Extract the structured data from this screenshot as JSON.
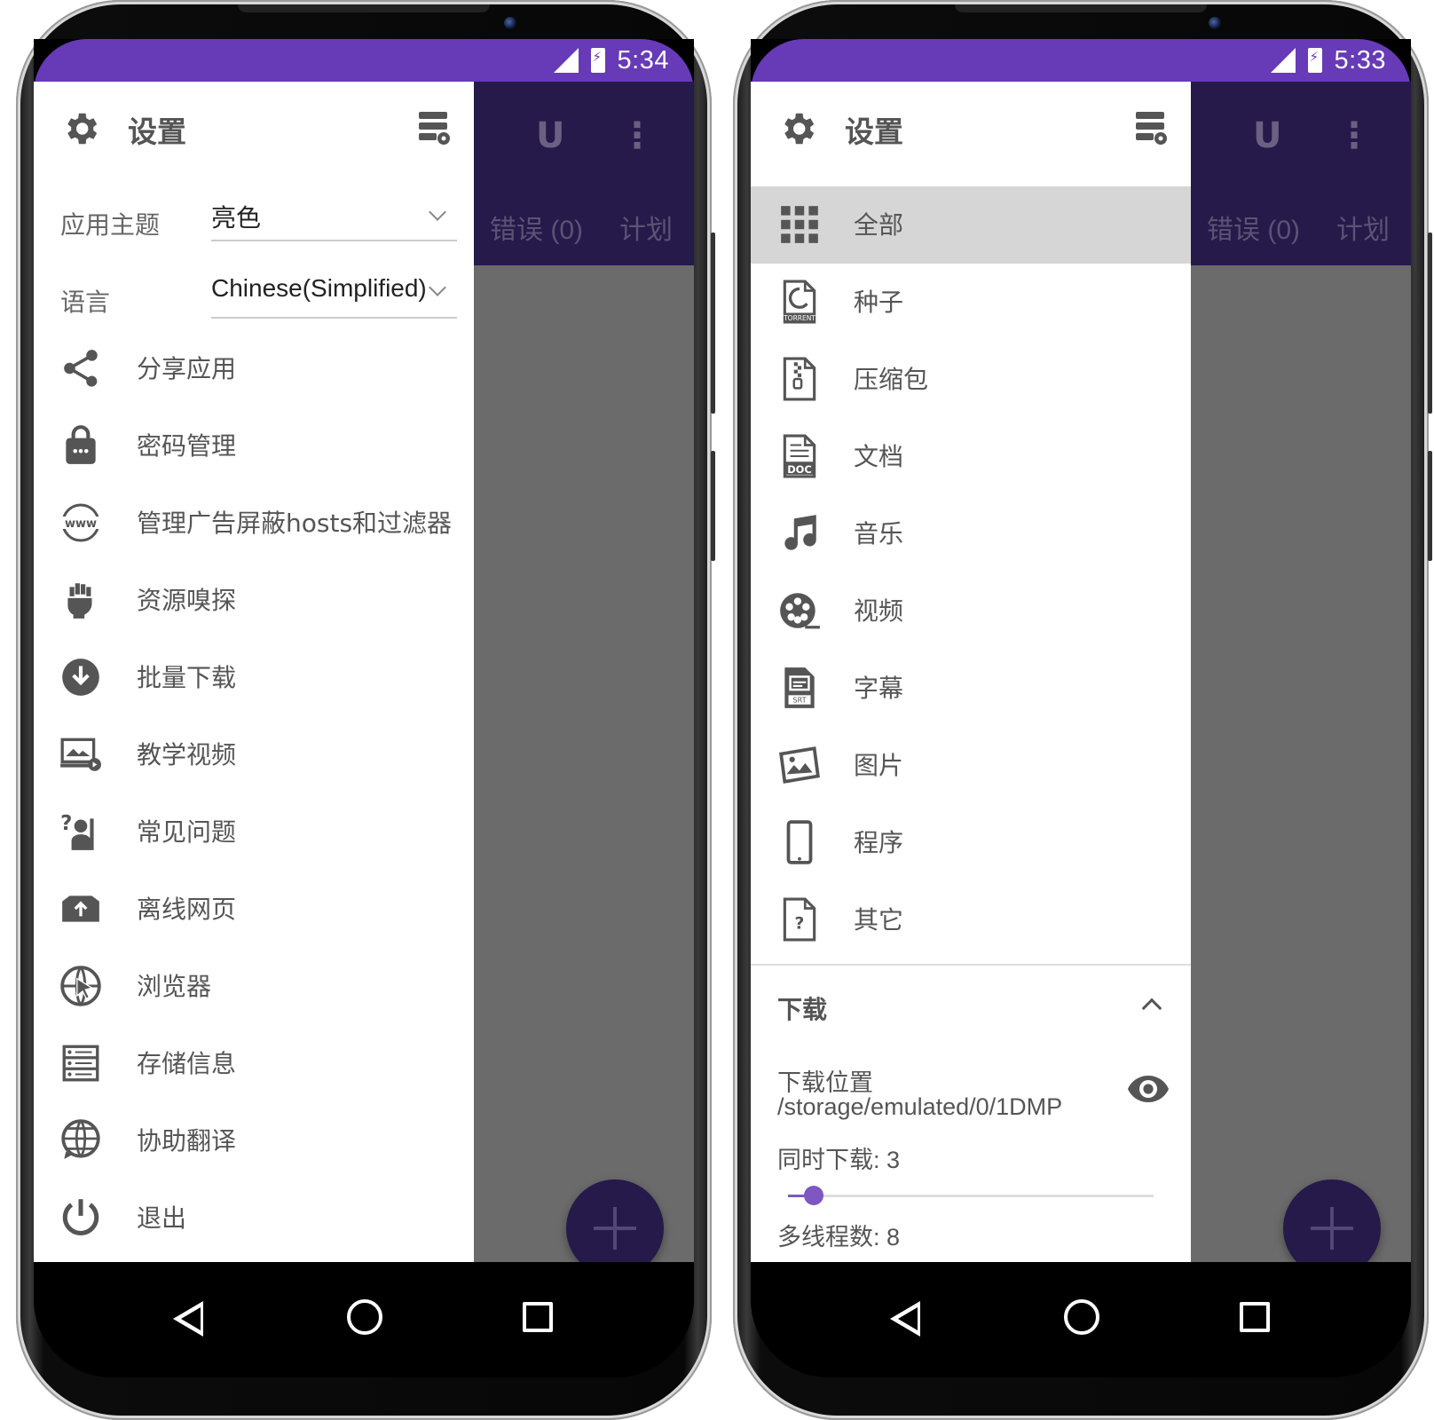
{
  "left": {
    "status": {
      "time": "5:34"
    },
    "tabs": {
      "error": "错误 (0)",
      "plan": "计划"
    },
    "drawer": {
      "title": "设置",
      "theme": {
        "label": "应用主题",
        "value": "亮色"
      },
      "language": {
        "label": "语言",
        "value": "Chinese(Simplified)"
      },
      "items": [
        {
          "label": "分享应用",
          "icon": "share-icon"
        },
        {
          "label": "密码管理",
          "icon": "lock-icon"
        },
        {
          "label": "管理广告屏蔽hosts和过滤器",
          "icon": "www-icon"
        },
        {
          "label": "资源嗅探",
          "icon": "fist-icon"
        },
        {
          "label": "批量下载",
          "icon": "download-circle-icon"
        },
        {
          "label": "教学视频",
          "icon": "tutorial-video-icon"
        },
        {
          "label": "常见问题",
          "icon": "faq-icon"
        },
        {
          "label": "离线网页",
          "icon": "offline-box-icon"
        },
        {
          "label": "浏览器",
          "icon": "globe-cursor-icon"
        },
        {
          "label": "存储信息",
          "icon": "storage-icon"
        },
        {
          "label": "协助翻译",
          "icon": "translate-globe-icon"
        },
        {
          "label": "退出",
          "icon": "power-icon"
        }
      ]
    }
  },
  "right": {
    "status": {
      "time": "5:33"
    },
    "tabs": {
      "error": "错误 (0)",
      "plan": "计划"
    },
    "drawer": {
      "title": "设置",
      "categories": [
        {
          "label": "全部",
          "icon": "grid-icon",
          "selected": true
        },
        {
          "label": "种子",
          "icon": "torrent-file-icon"
        },
        {
          "label": "压缩包",
          "icon": "zip-file-icon"
        },
        {
          "label": "文档",
          "icon": "doc-file-icon"
        },
        {
          "label": "音乐",
          "icon": "music-note-icon"
        },
        {
          "label": "视频",
          "icon": "film-reel-icon"
        },
        {
          "label": "字幕",
          "icon": "srt-file-icon"
        },
        {
          "label": "图片",
          "icon": "picture-icon"
        },
        {
          "label": "程序",
          "icon": "phone-app-icon"
        },
        {
          "label": "其它",
          "icon": "unknown-file-icon"
        }
      ],
      "download": {
        "section_title": "下载",
        "location_label": "下载位置",
        "location_path": "/storage/emulated/0/1DMP",
        "simultaneous_label": "同时下载:",
        "simultaneous_value": "3",
        "simultaneous_fraction": 0.07,
        "threads_label": "多线程数:",
        "threads_value": "8"
      }
    }
  }
}
